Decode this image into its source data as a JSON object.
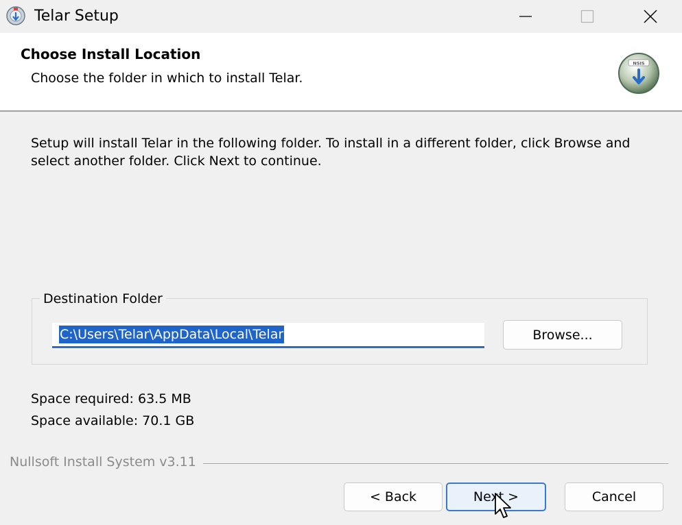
{
  "window": {
    "title": "Telar Setup",
    "app_icon": "installer-disc-icon",
    "controls": {
      "minimize": "minimize-icon",
      "maximize": "maximize-icon",
      "close": "close-icon"
    }
  },
  "header": {
    "title": "Choose Install Location",
    "subtitle": "Choose the folder in which to install Telar.",
    "logo": "nsis-logo-icon",
    "logo_text": "NSIS"
  },
  "body": {
    "intro": "Setup will install Telar in the following folder. To install in a different folder, click Browse and select another folder. Click Next to continue.",
    "destination": {
      "legend": "Destination Folder",
      "path": "C:\\Users\\Telar\\AppData\\Local\\Telar",
      "browse_label": "Browse..."
    },
    "space_required": "Space required: 63.5 MB",
    "space_available": "Space available: 70.1 GB"
  },
  "footer": {
    "branding": "Nullsoft Install System v3.11",
    "back_label": "< Back",
    "next_label": "Next >",
    "cancel_label": "Cancel"
  },
  "colors": {
    "accent": "#1f64c8",
    "focus_border": "#3b78d4",
    "window_bg": "#f0f0f0"
  }
}
